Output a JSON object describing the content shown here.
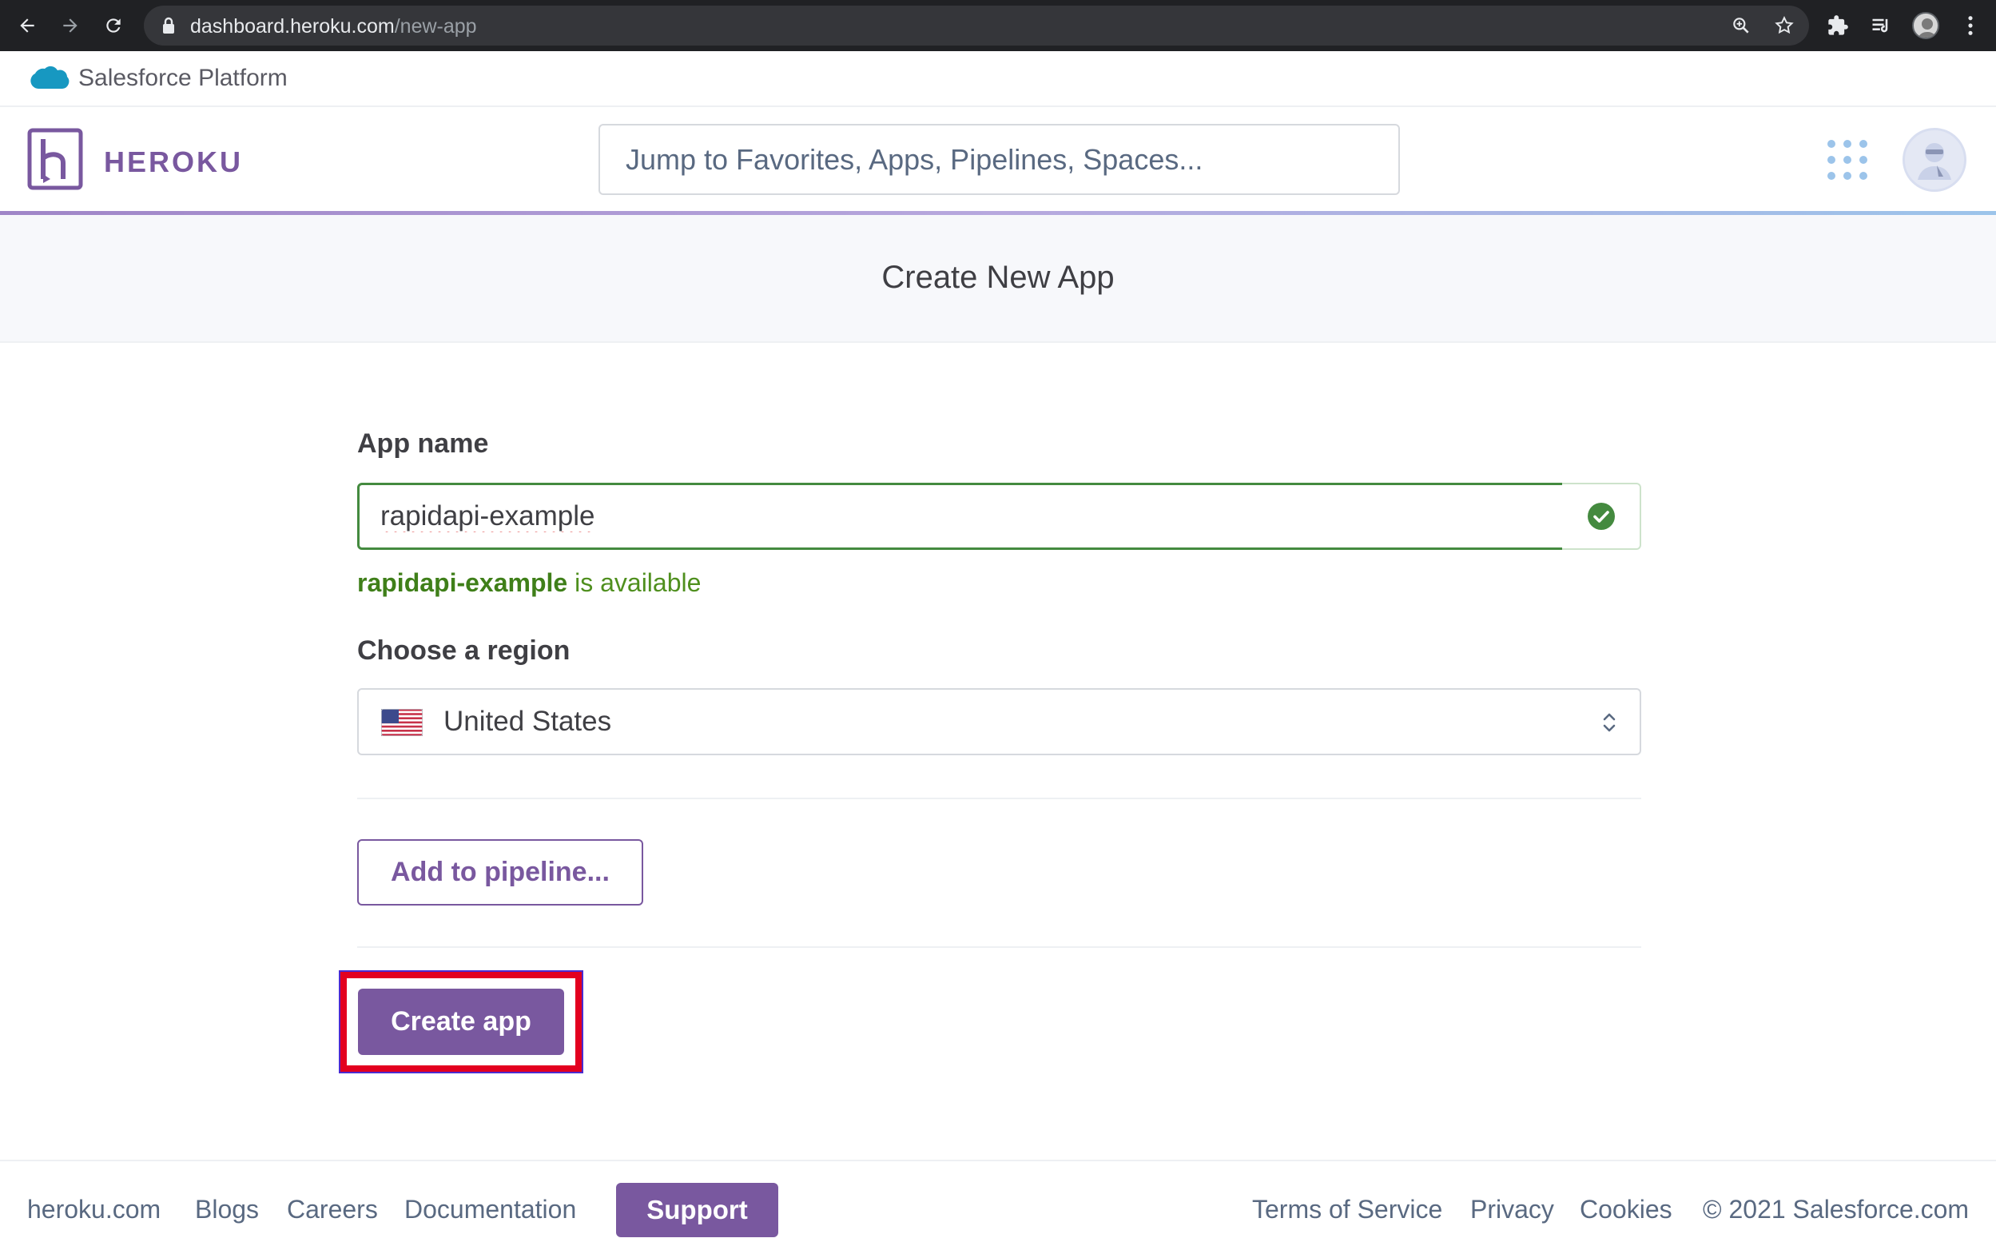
{
  "browser": {
    "url_host": "dashboard.heroku.com",
    "url_path": "/new-app"
  },
  "salesforce_bar": {
    "label": "Salesforce Platform"
  },
  "header": {
    "brand": "HEROKU",
    "search_placeholder": "Jump to Favorites, Apps, Pipelines, Spaces..."
  },
  "page": {
    "title": "Create New App"
  },
  "form": {
    "app_name_label": "App name",
    "app_name_value": "rapidapi-example",
    "availability_name": "rapidapi-example",
    "availability_suffix": " is available",
    "region_label": "Choose a region",
    "region_value": "United States",
    "pipeline_button": "Add to pipeline...",
    "create_button": "Create app"
  },
  "footer": {
    "links": [
      "heroku.com",
      "Blogs",
      "Careers",
      "Documentation"
    ],
    "support": "Support",
    "right_links": [
      "Terms of Service",
      "Privacy",
      "Cookies"
    ],
    "copyright": "© 2021 Salesforce.com"
  },
  "colors": {
    "heroku_purple": "#79589f",
    "success_green": "#448a3f",
    "highlight_red": "#e3001f"
  }
}
